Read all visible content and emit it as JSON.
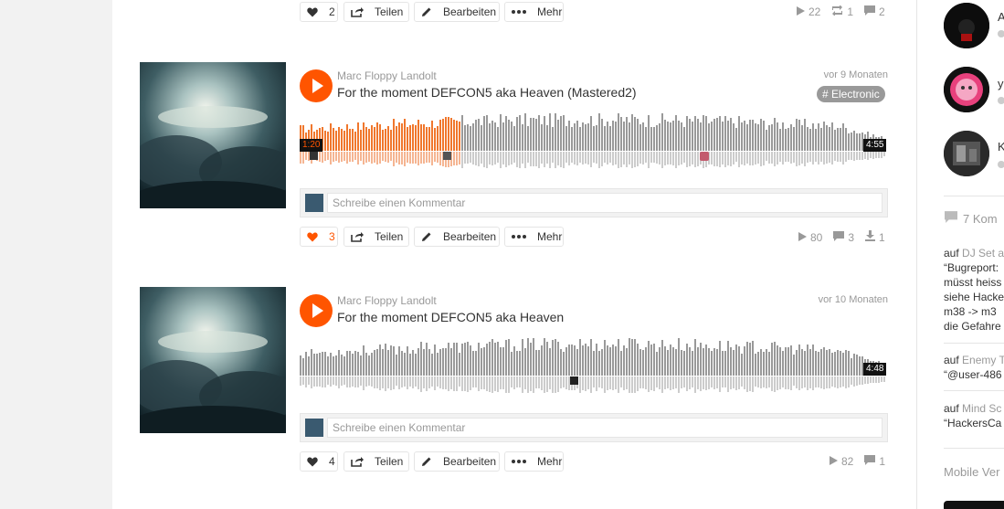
{
  "top_actions": {
    "like_count": "2",
    "share": "Teilen",
    "edit": "Bearbeiten",
    "more": "Mehr",
    "stats": {
      "plays": "22",
      "reposts": "1",
      "comments": "2"
    }
  },
  "tracks": [
    {
      "user": "Marc Floppy Landolt",
      "title": "For the moment DEFCON5 aka Heaven (Mastered2)",
      "ago": "vor 9 Monaten",
      "tag": "# Electronic",
      "elapsed": "1:20",
      "duration": "4:55",
      "progress": 0.272,
      "comment_placeholder": "Schreibe einen Kommentar",
      "like_count": "3",
      "liked": true,
      "share": "Teilen",
      "edit": "Bearbeiten",
      "more": "Mehr",
      "stats": {
        "plays": "80",
        "comments": "3",
        "downloads": "1"
      }
    },
    {
      "user": "Marc Floppy Landolt",
      "title": "For the moment DEFCON5 aka Heaven",
      "ago": "vor 10 Monaten",
      "duration": "4:48",
      "progress": 0,
      "comment_placeholder": "Schreibe einen Kommentar",
      "like_count": "4",
      "liked": false,
      "share": "Teilen",
      "edit": "Bearbeiten",
      "more": "Mehr",
      "stats": {
        "plays": "82",
        "comments": "1"
      }
    }
  ],
  "sidebar": {
    "users": [
      {
        "name": "A"
      },
      {
        "name": "y"
      },
      {
        "name": "K"
      }
    ],
    "comments_header": "7 Kom",
    "comments": [
      {
        "prefix": "auf",
        "track": "DJ Set a",
        "lines": [
          "“Bugreport:",
          "müsst heiss",
          "siehe Hacke",
          "m38 -> m3",
          "die Gefahre"
        ]
      },
      {
        "prefix": "auf",
        "track": "Enemy T",
        "lines": [
          "“@user-486"
        ]
      },
      {
        "prefix": "auf",
        "track": "Mind Sc",
        "lines": [
          "“HackersCa"
        ]
      }
    ],
    "footer": "Mobile Ver"
  },
  "colors": {
    "accent": "#ff5500",
    "wave_gray": "#999999",
    "wave_played": "#f0772d"
  }
}
